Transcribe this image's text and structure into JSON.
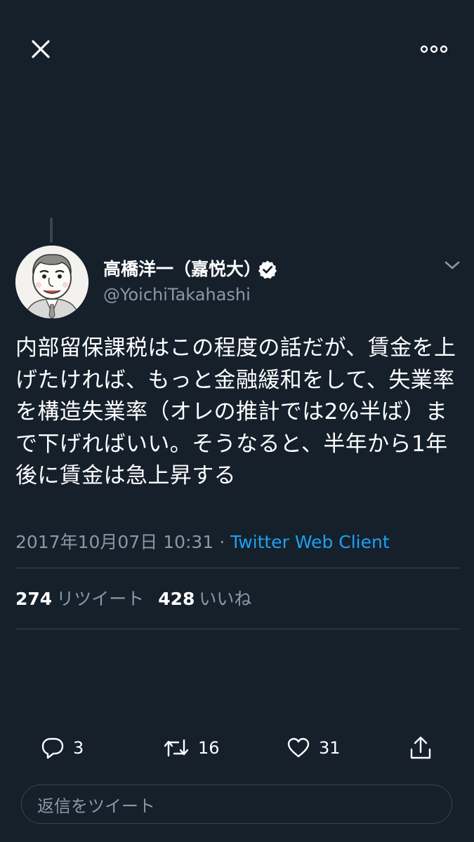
{
  "header": {
    "close_icon": "close-icon",
    "more_icon": "more-horizontal-icon"
  },
  "tweet": {
    "author": {
      "name": "高橋洋一（嘉悦大）",
      "handle": "@YoichiTakahashi",
      "verified": true
    },
    "text": "内部留保課税はこの程度の話だが、賃金を上げたければ、もっと金融緩和をして、失業率を構造失業率（オレの推計では2%半ば）まで下げればいい。そうなると、半年から1年後に賃金は急上昇する",
    "timestamp": "2017年10月07日 10:31",
    "separator": " · ",
    "client": "Twitter Web Client"
  },
  "stats": {
    "retweets": "274",
    "retweets_label": "リツイート",
    "likes": "428",
    "likes_label": "いいね"
  },
  "actions": {
    "reply_count": "3",
    "retweet_count": "16",
    "like_count": "31"
  },
  "reply_box": {
    "placeholder": "返信をツイート"
  },
  "colors": {
    "background": "#15202b",
    "text": "#ffffff",
    "secondary": "#8899a6",
    "accent": "#1da1f2",
    "border": "#38444d"
  }
}
